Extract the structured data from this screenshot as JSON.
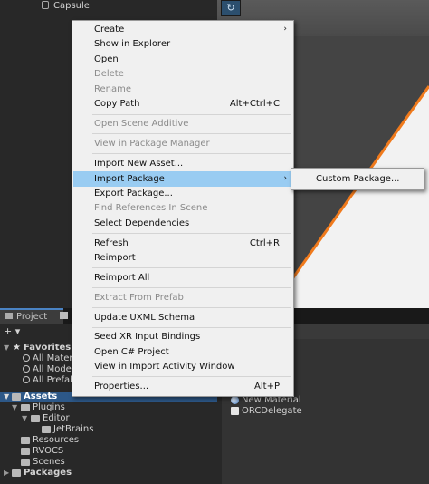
{
  "hierarchy": {
    "capsule_label": "Capsule"
  },
  "scene": {
    "gizmo_glyph": "↻"
  },
  "context_menu": {
    "items": [
      {
        "label": "Create",
        "shortcut": "",
        "submenu": true,
        "disabled": false
      },
      {
        "label": "Show in Explorer",
        "shortcut": "",
        "submenu": false,
        "disabled": false
      },
      {
        "label": "Open",
        "shortcut": "",
        "submenu": false,
        "disabled": false
      },
      {
        "label": "Delete",
        "shortcut": "",
        "submenu": false,
        "disabled": true
      },
      {
        "label": "Rename",
        "shortcut": "",
        "submenu": false,
        "disabled": true
      },
      {
        "label": "Copy Path",
        "shortcut": "Alt+Ctrl+C",
        "submenu": false,
        "disabled": false
      },
      {
        "label": "Open Scene Additive",
        "shortcut": "",
        "submenu": false,
        "disabled": true
      },
      {
        "label": "View in Package Manager",
        "shortcut": "",
        "submenu": false,
        "disabled": true
      },
      {
        "label": "Import New Asset...",
        "shortcut": "",
        "submenu": false,
        "disabled": false
      },
      {
        "label": "Import Package",
        "shortcut": "",
        "submenu": true,
        "disabled": false,
        "highlighted": true
      },
      {
        "label": "Export Package...",
        "shortcut": "",
        "submenu": false,
        "disabled": false
      },
      {
        "label": "Find References In Scene",
        "shortcut": "",
        "submenu": false,
        "disabled": true
      },
      {
        "label": "Select Dependencies",
        "shortcut": "",
        "submenu": false,
        "disabled": false
      },
      {
        "label": "Refresh",
        "shortcut": "Ctrl+R",
        "submenu": false,
        "disabled": false
      },
      {
        "label": "Reimport",
        "shortcut": "",
        "submenu": false,
        "disabled": false
      },
      {
        "label": "Reimport All",
        "shortcut": "",
        "submenu": false,
        "disabled": false
      },
      {
        "label": "Extract From Prefab",
        "shortcut": "",
        "submenu": false,
        "disabled": true
      },
      {
        "label": "Update UXML Schema",
        "shortcut": "",
        "submenu": false,
        "disabled": false
      },
      {
        "label": "Seed XR Input Bindings",
        "shortcut": "",
        "submenu": false,
        "disabled": false
      },
      {
        "label": "Open C# Project",
        "shortcut": "",
        "submenu": false,
        "disabled": false
      },
      {
        "label": "View in Import Activity Window",
        "shortcut": "",
        "submenu": false,
        "disabled": false
      },
      {
        "label": "Properties...",
        "shortcut": "Alt+P",
        "submenu": false,
        "disabled": false
      }
    ],
    "submenu_arrow": "›"
  },
  "submenu": {
    "items": [
      {
        "label": "Custom Package..."
      }
    ]
  },
  "project": {
    "tabs": [
      {
        "label": "Project"
      }
    ],
    "toolbar_add": "+ ▾",
    "tree": [
      {
        "label": "Favorites",
        "arrow": "▼",
        "icon": "star-icon"
      },
      {
        "label": "All Materi",
        "icon": "search-icon"
      },
      {
        "label": "All Models",
        "icon": "search-icon"
      },
      {
        "label": "All Prefab",
        "icon": "search-icon"
      },
      {
        "label": "Assets",
        "arrow": "▼",
        "icon": "folder-icon",
        "selected": true
      },
      {
        "label": "Plugins",
        "arrow": "▼",
        "icon": "folder-icon"
      },
      {
        "label": "Editor",
        "arrow": "▼",
        "icon": "folder-icon"
      },
      {
        "label": "JetBrains",
        "icon": "folder-icon"
      },
      {
        "label": "Resources",
        "icon": "folder-icon"
      },
      {
        "label": "RVOCS",
        "icon": "folder-icon"
      },
      {
        "label": "Scenes",
        "icon": "folder-icon"
      },
      {
        "label": "Packages",
        "arrow": "▶",
        "icon": "folder-icon"
      }
    ]
  },
  "assets": {
    "items": [
      {
        "label": "New Material",
        "icon": "material-icon"
      },
      {
        "label": "ORCDelegate",
        "icon": "script-icon"
      }
    ]
  },
  "colors": {
    "accent": "#99ccf2",
    "selection": "#2d5888",
    "scene_edge": "#f07a1c"
  }
}
